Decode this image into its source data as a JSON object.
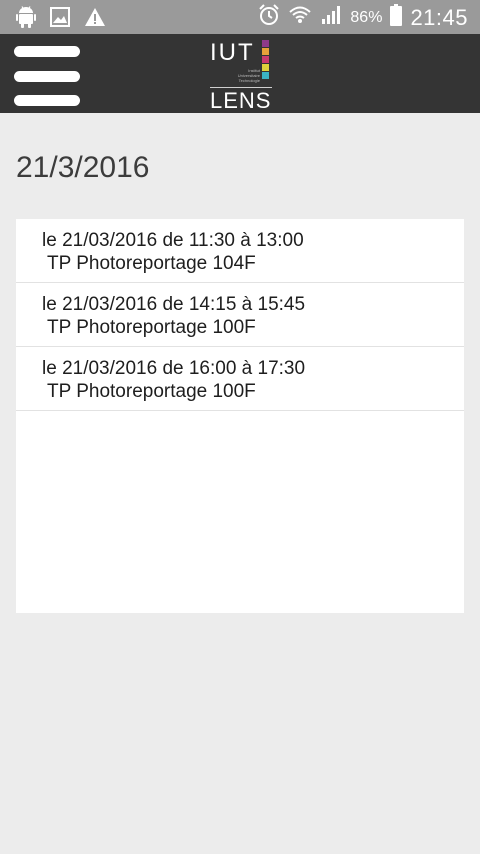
{
  "status_bar": {
    "left_icons": [
      "android-icon",
      "image-icon",
      "warning-icon"
    ],
    "right_icons": [
      "alarm-icon",
      "wifi-icon",
      "signal-icon",
      "battery-icon"
    ],
    "battery_percent": "86%",
    "time": "21:45",
    "background": "#9a9a9a"
  },
  "app_bar": {
    "background": "#343434",
    "logo": {
      "top_text": "IUT",
      "subtitle_lines": [
        "Institut",
        "Universitaire",
        "Technologie"
      ],
      "bottom_text": "LENS",
      "accent_colors": [
        "#8e3a8a",
        "#e8a13a",
        "#c93a6e",
        "#e0d23c",
        "#3bb3c3"
      ]
    }
  },
  "page": {
    "date": "21/3/2016"
  },
  "events": [
    {
      "when": "le 21/03/2016 de 11:30 à 13:00",
      "title": "TP Photoreportage 104F"
    },
    {
      "when": "le 21/03/2016 de 14:15 à 15:45",
      "title": "TP Photoreportage 100F"
    },
    {
      "when": "le 21/03/2016 de 16:00 à 17:30",
      "title": "TP Photoreportage 100F"
    }
  ]
}
